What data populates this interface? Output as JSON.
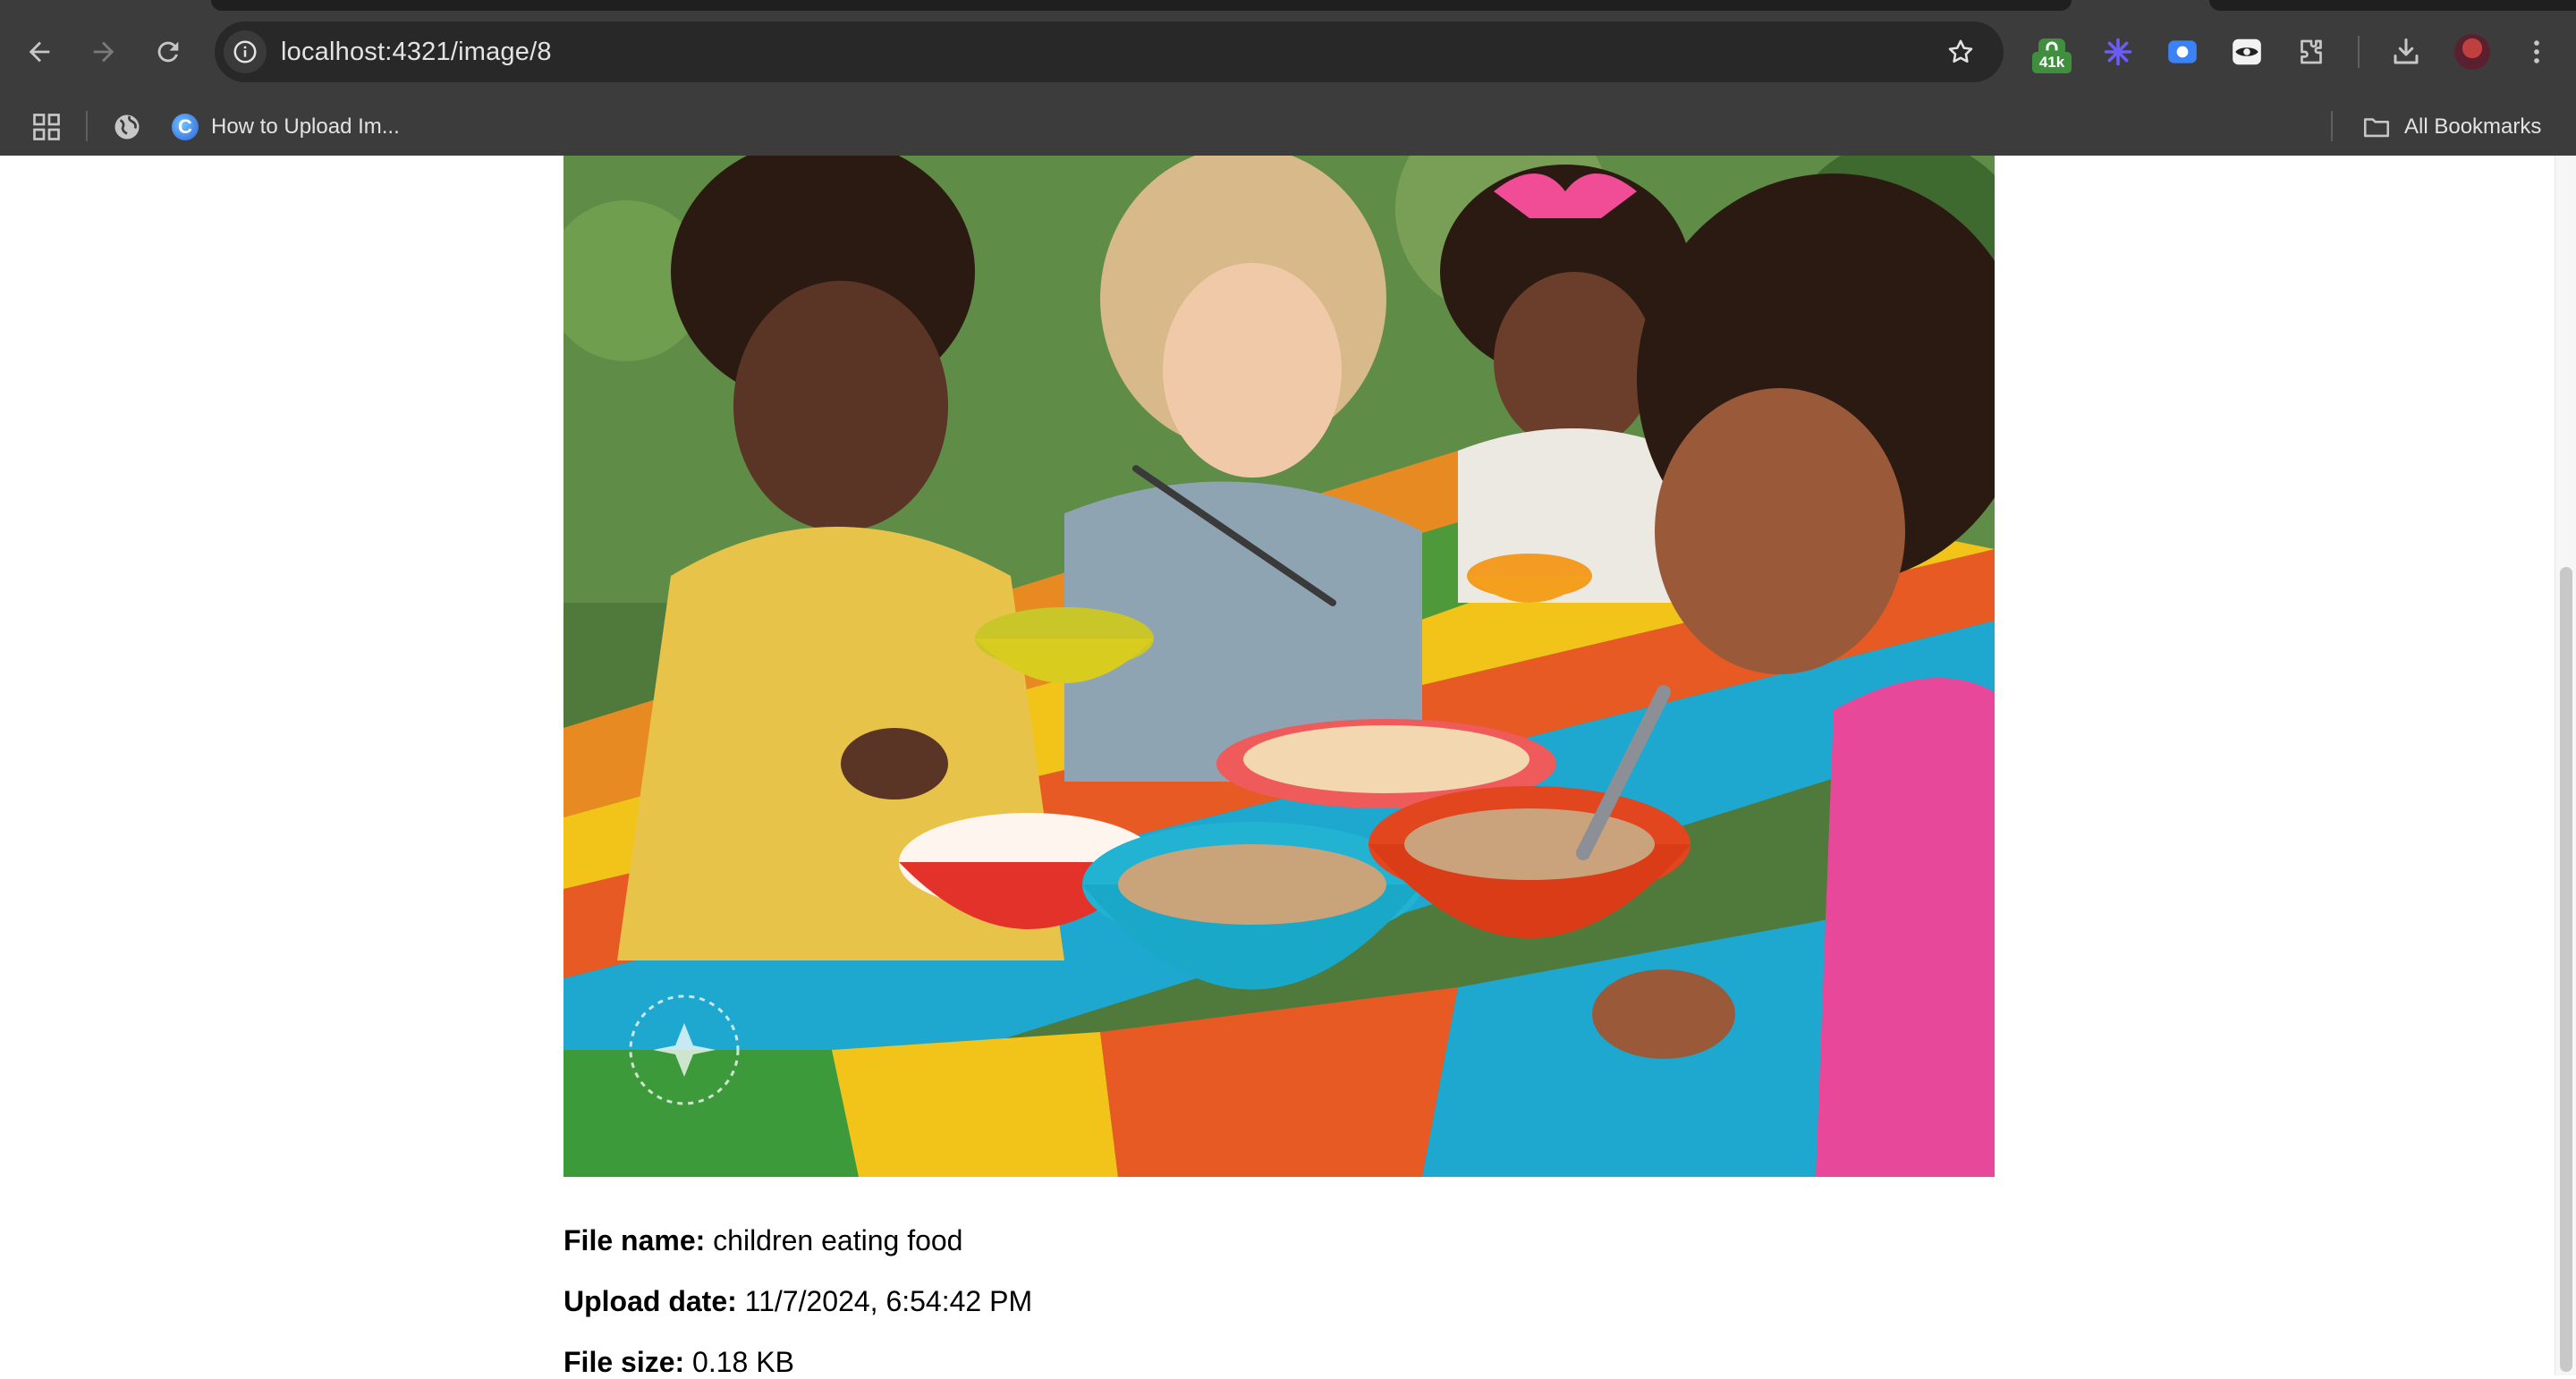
{
  "browser": {
    "url": "localhost:4321/image/8",
    "extension_badge": "41k",
    "bookmarks": [
      {
        "label": "How to Upload Im...",
        "favicon": "C"
      }
    ],
    "all_bookmarks_label": "All Bookmarks"
  },
  "image": {
    "alt": "children eating food",
    "watermark": "IMAGINED WITH AI",
    "colors": {
      "yellow_plank": "#f2c419",
      "orange_plank": "#e85a23",
      "blue_plank": "#1ea7cf",
      "green_plank": "#3d9a3a",
      "teal_bowl": "#1aa8c8",
      "red_bowl": "#e2461f"
    }
  },
  "details": {
    "file_name_label": "File name:",
    "file_name": "children eating food",
    "upload_date_label": "Upload date:",
    "upload_date": "11/7/2024, 6:54:42 PM",
    "file_size_label": "File size:",
    "file_size": "0.18 KB"
  },
  "icons": {
    "back": "arrow-left-icon",
    "forward": "arrow-right-icon",
    "reload": "reload-icon",
    "info": "info-icon",
    "star": "star-icon",
    "downloads": "download-icon",
    "menu": "kebab-menu-icon",
    "apps": "apps-grid-icon",
    "folder": "folder-icon"
  }
}
